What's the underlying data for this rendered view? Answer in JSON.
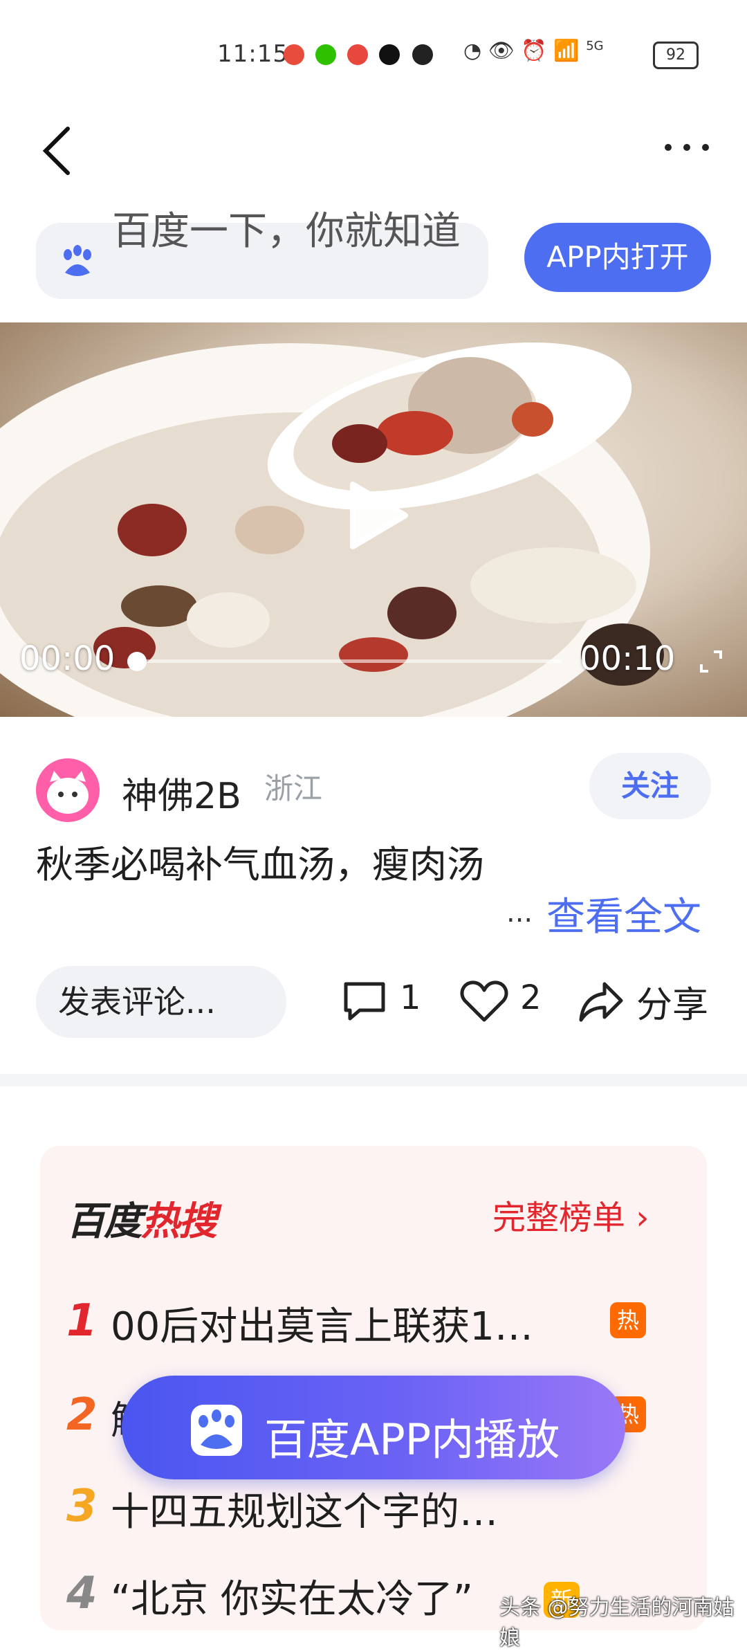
{
  "status_bar": {
    "time": "11:15",
    "signal": "5G",
    "battery": "92"
  },
  "nav": {
    "back_icon": "back-chevron-icon",
    "more_icon": "more-dots-icon"
  },
  "search": {
    "placeholder": "百度一下，你就知道",
    "open_button": "APP内打开"
  },
  "video": {
    "time_current": "00:00",
    "time_total": "00:10",
    "progress": 0
  },
  "author": {
    "name": "神佛2B",
    "location": "浙江",
    "follow_label": "关注"
  },
  "post": {
    "title": "秋季必喝补气血汤，瘦肉汤",
    "ellipsis": "...",
    "read_more": "查看全文"
  },
  "actions": {
    "comment_placeholder": "发表评论...",
    "comment_count": "1",
    "like_count": "2",
    "share_label": "分享"
  },
  "hot_list": {
    "logo_part1": "百度",
    "logo_part2": "热搜",
    "full_list_label": "完整榜单 ›",
    "items": [
      {
        "rank": "1",
        "title": "00后对出莫言上联获1…",
        "badge": "热",
        "color": "#e1262e"
      },
      {
        "rank": "2",
        "title": "解",
        "badge": "热",
        "color": "#f26522"
      },
      {
        "rank": "3",
        "title": "十四五规划这个字的…",
        "badge": "",
        "color": "#f5a623"
      },
      {
        "rank": "4",
        "title": "“北京 你实在太冷了”",
        "badge": "新",
        "color": "#888888"
      }
    ]
  },
  "floating_button": {
    "label": "百度APP内播放"
  },
  "watermark": "头条 @努力生活的河南姑娘"
}
